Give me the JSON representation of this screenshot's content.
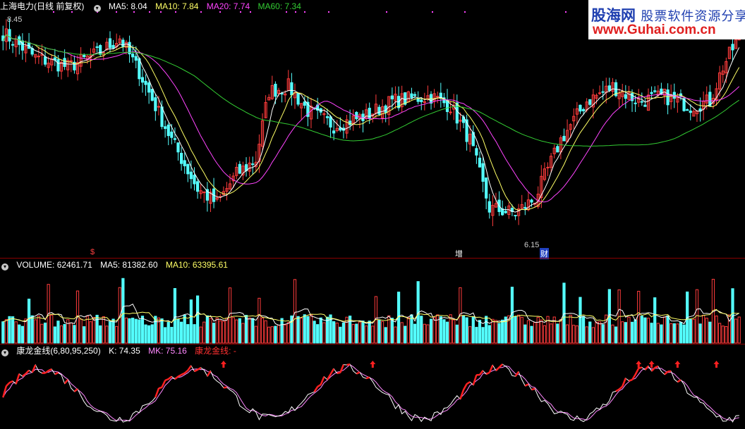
{
  "panel_price": {
    "stock_label": "上海电力(日线 前复权)",
    "ma5": "MA5: 8.04",
    "ma10": "MA10: 7.84",
    "ma20": "MA20: 7.74",
    "ma60": "MA60: 7.34",
    "high_label": "8.45",
    "low_label": "6.15",
    "events": [
      "$",
      "增",
      "财"
    ],
    "colors": {
      "up": "#ff3c3c",
      "down": "#54ffff",
      "ma5": "#ffffff",
      "ma10": "#ffff66",
      "ma20": "#ff44ff",
      "ma60": "#33cc33"
    }
  },
  "panel_volume": {
    "label": "VOLUME: 62461.71",
    "ma5": "MA5: 81382.60",
    "ma10": "MA10: 63395.61"
  },
  "panel_indicator": {
    "name": "康龙金线(6,80,95,250)",
    "k": "K: 74.35",
    "mk": "MK: 75.16",
    "signal": "康龙金线: -"
  },
  "watermark": {
    "brand": "股海网",
    "slogan": "股票软件资源分享",
    "url": "www.Guhai.com.cn"
  },
  "chart_data": {
    "type": "candlestick",
    "price_range": [
      6.15,
      8.45
    ],
    "close_series_keypoints": [
      [
        0,
        8.3
      ],
      [
        10,
        8.05
      ],
      [
        20,
        7.95
      ],
      [
        30,
        8.1
      ],
      [
        36,
        8.25
      ],
      [
        42,
        7.9
      ],
      [
        52,
        7.2
      ],
      [
        60,
        6.7
      ],
      [
        66,
        6.55
      ],
      [
        72,
        6.85
      ],
      [
        78,
        7.0
      ],
      [
        82,
        7.7
      ],
      [
        88,
        7.75
      ],
      [
        94,
        7.5
      ],
      [
        102,
        7.35
      ],
      [
        112,
        7.45
      ],
      [
        120,
        7.6
      ],
      [
        132,
        7.65
      ],
      [
        138,
        7.55
      ],
      [
        144,
        7.2
      ],
      [
        150,
        6.5
      ],
      [
        158,
        6.45
      ],
      [
        164,
        6.6
      ],
      [
        172,
        7.2
      ],
      [
        180,
        7.6
      ],
      [
        188,
        7.75
      ],
      [
        196,
        7.6
      ],
      [
        204,
        7.65
      ],
      [
        212,
        7.55
      ],
      [
        218,
        7.6
      ],
      [
        222,
        7.95
      ],
      [
        226,
        8.2
      ]
    ],
    "volume_range": [
      0,
      140000
    ],
    "k_range": [
      0,
      100
    ],
    "buy_arrow_bars": [
      68,
      114,
      196,
      200,
      208,
      220
    ]
  }
}
